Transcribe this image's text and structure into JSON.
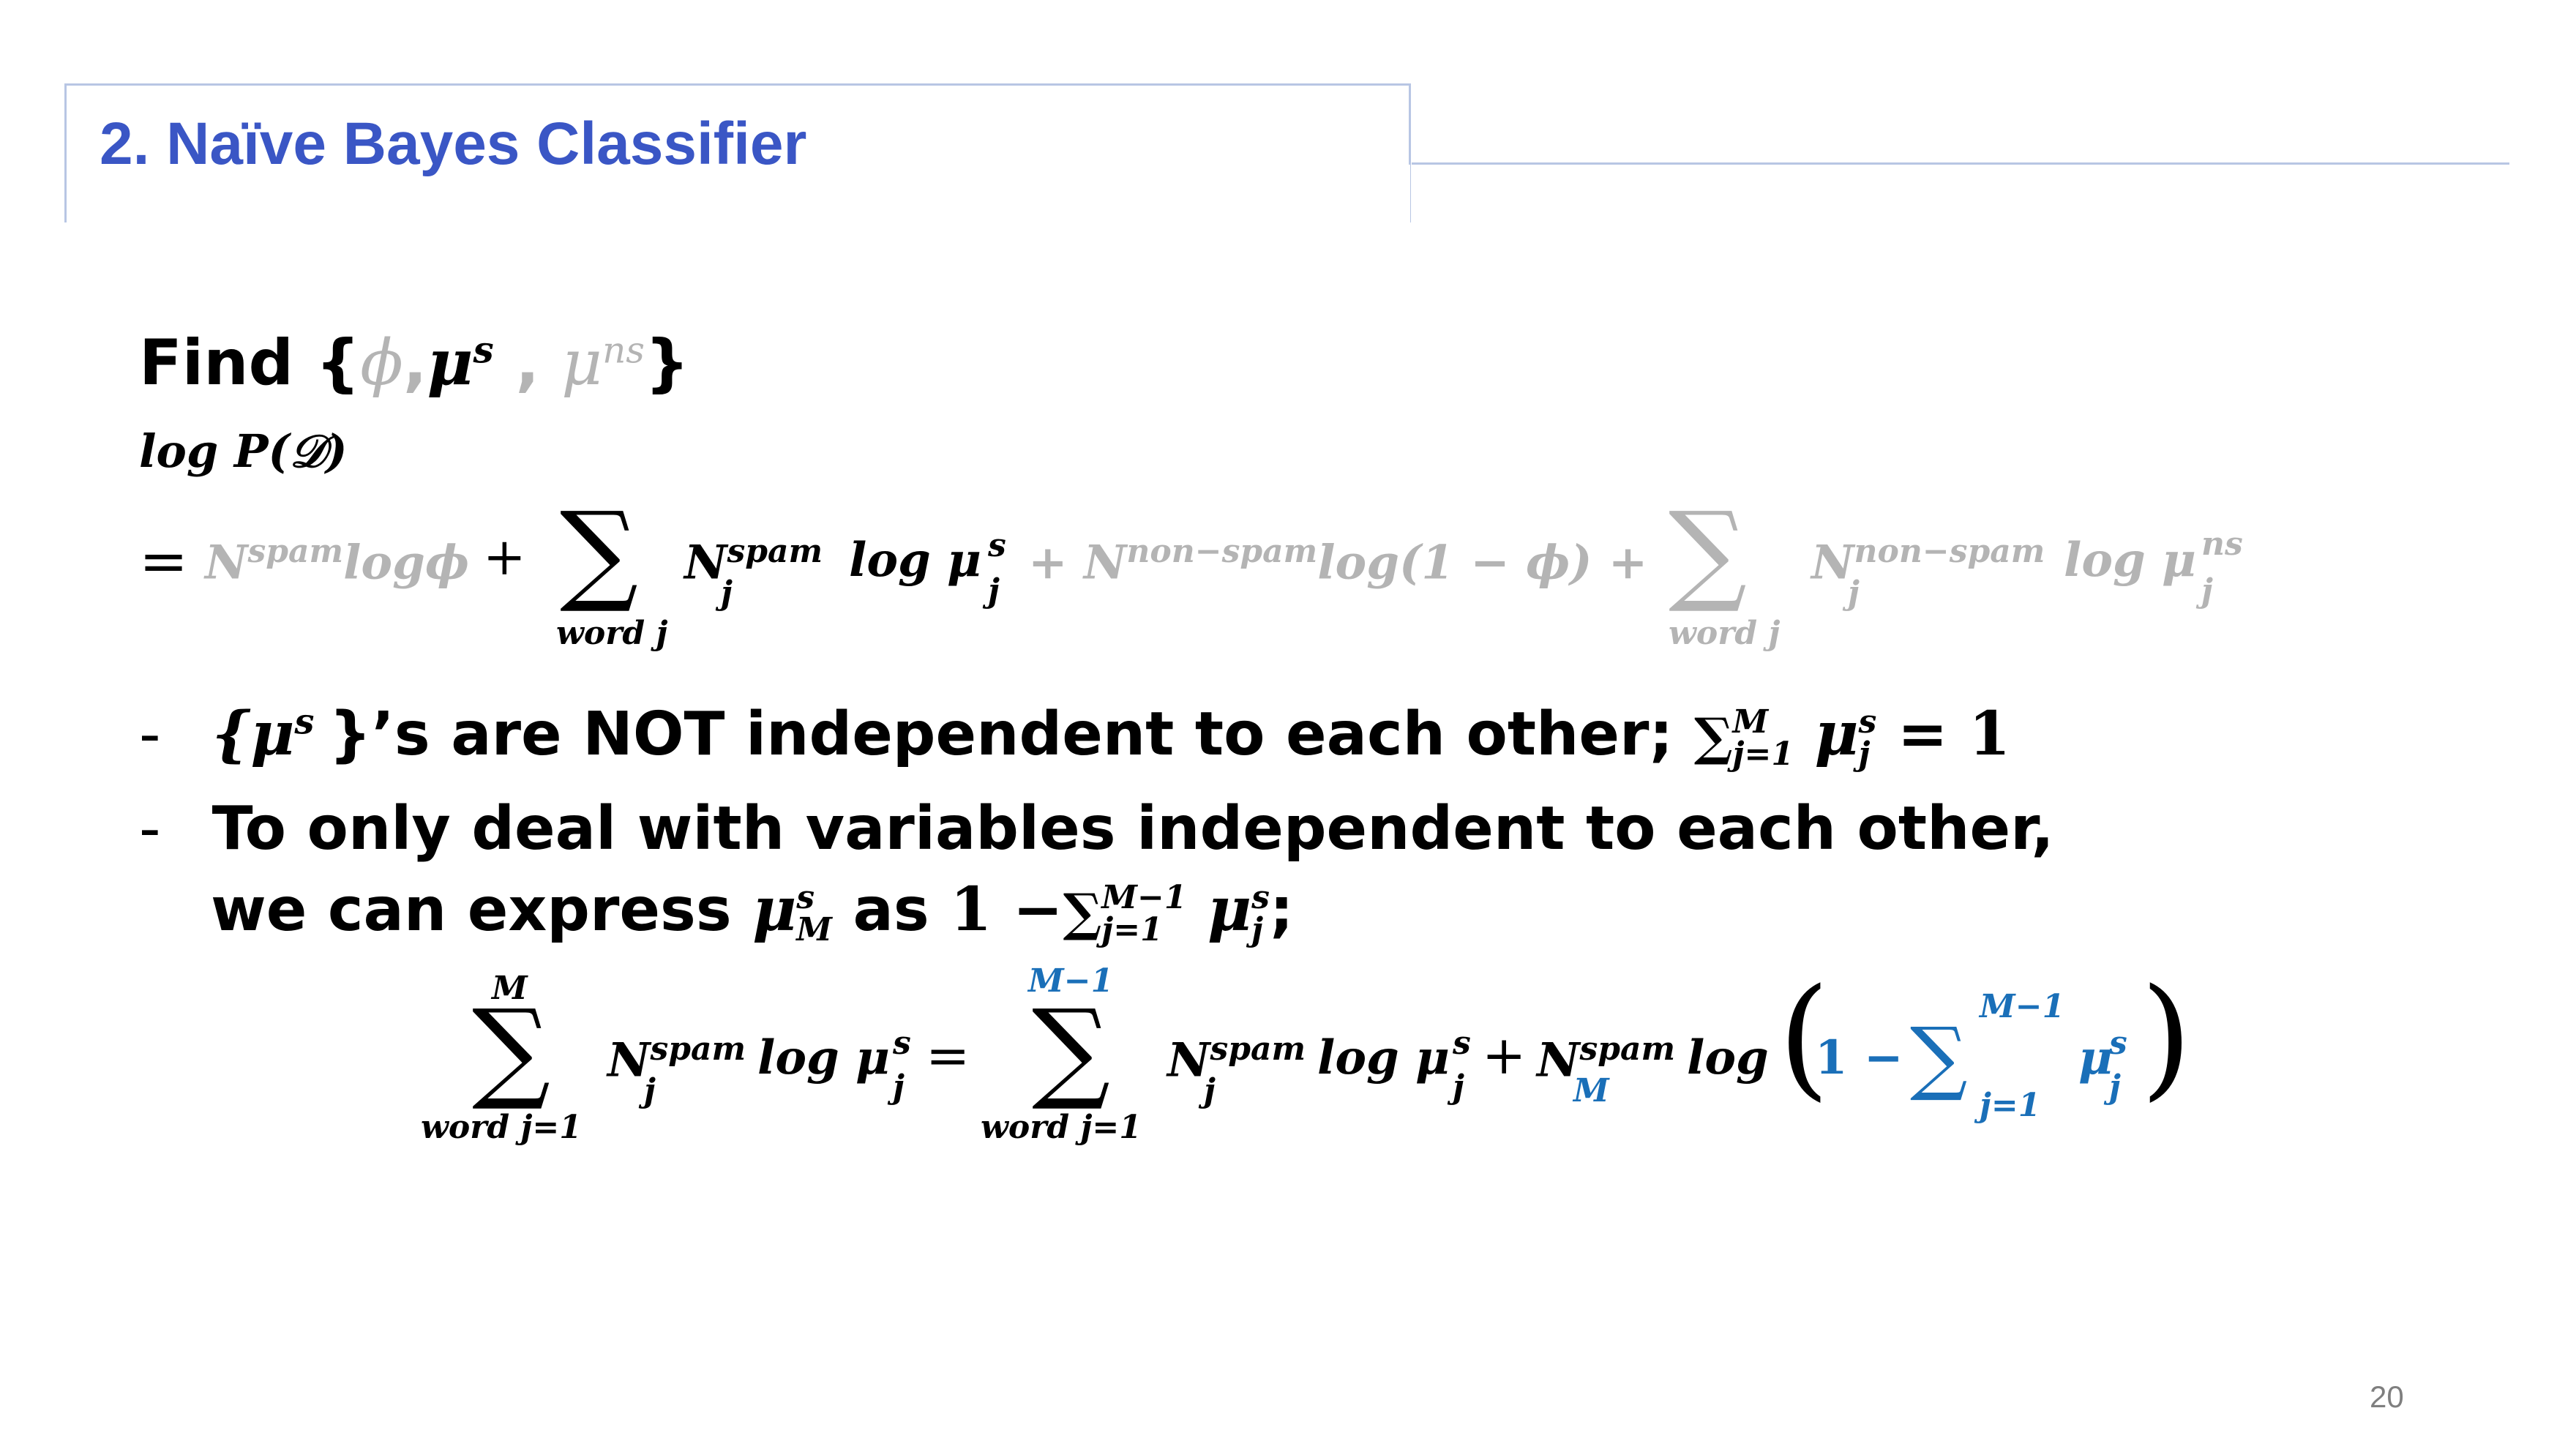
{
  "slide": {
    "title": "2. Naïve Bayes Classifier",
    "page_number": "20"
  },
  "find_line": {
    "prefix": "Find {",
    "phi": "ϕ",
    "comma1": ",",
    "mu": "μ",
    "s": "s",
    "comma2": ",",
    "mu2": "μ",
    "ns": "ns",
    "close": "}"
  },
  "log_line": "log P(𝒟)",
  "equation1": {
    "eq": "=",
    "N": "N",
    "spam": "spam",
    "logphi": "logϕ",
    "plus1": "+",
    "sum": "∑",
    "word_j": "word j",
    "Nj": "N",
    "j": "j",
    "spam2": "spam",
    "log_mu": "log μ",
    "s": "s",
    "j2": "j",
    "plus2": "+ N",
    "non_spam": "non−spam",
    "log_one_minus_phi": "log(1 − ϕ) +",
    "sum2": "∑",
    "word_j2": "word j",
    "N3": "N",
    "non_spam2": "non−spam",
    "j3": "j",
    "log_mu2": "log μ",
    "ns": "ns",
    "j4": "j"
  },
  "bullets": {
    "dash": "-",
    "b1_open": "{μ",
    "b1_s": "s",
    "b1_text": "}’s are NOT independent to each other;",
    "b1_sum": "∑",
    "b1_sum_sup": "M",
    "b1_sum_sub": "j=1",
    "b1_mu": "μ",
    "b1_mu_s": "s",
    "b1_mu_j": "j",
    "b1_eq": "= 1",
    "b2_line1": "To only deal with variables independent to each other,",
    "b2_line2_a": "we can express",
    "b2_mu": "μ",
    "b2_mu_s": "s",
    "b2_mu_M": "M",
    "b2_as": "as",
    "b2_one_minus": "1 −",
    "b2_sum": "∑",
    "b2_sum_sup": "M−1",
    "b2_sum_sub": "j=1",
    "b2_mu2": "μ",
    "b2_mu2_s": "s",
    "b2_mu2_j": "j",
    "b2_semicolon": ";"
  },
  "equation2": {
    "lhs_sum_top": "M",
    "lhs_sum": "∑",
    "lhs_sum_bottom": "word j=1",
    "lhs_N": "N",
    "lhs_spam": "spam",
    "lhs_j": "j",
    "lhs_log_mu": "log μ",
    "lhs_s": "s",
    "lhs_j2": "j",
    "eq": "=",
    "rhs_sum_top": "M−1",
    "rhs_sum": "∑",
    "rhs_sum_bottom": "word j=1",
    "rhs_N": "N",
    "rhs_spam": "spam",
    "rhs_j": "j",
    "rhs_log_mu": "log μ",
    "rhs_s": "s",
    "rhs_j2": "j",
    "plus": "+",
    "rhs_N2": "N",
    "rhs_spam2": "spam",
    "rhs_M": "M",
    "rhs_log": "log",
    "open_paren": "(",
    "one_minus": "1 −",
    "inner_sum": "∑",
    "inner_sum_top": "M−1",
    "inner_sum_bottom": "j=1",
    "inner_mu": "μ",
    "inner_s": "s",
    "inner_j": "j",
    "close_paren": ")"
  },
  "colors": {
    "title": "#3a56c5",
    "frame": "#b8c6e4",
    "faded": "#b4b4b4",
    "highlight": "#1a6fb8"
  }
}
